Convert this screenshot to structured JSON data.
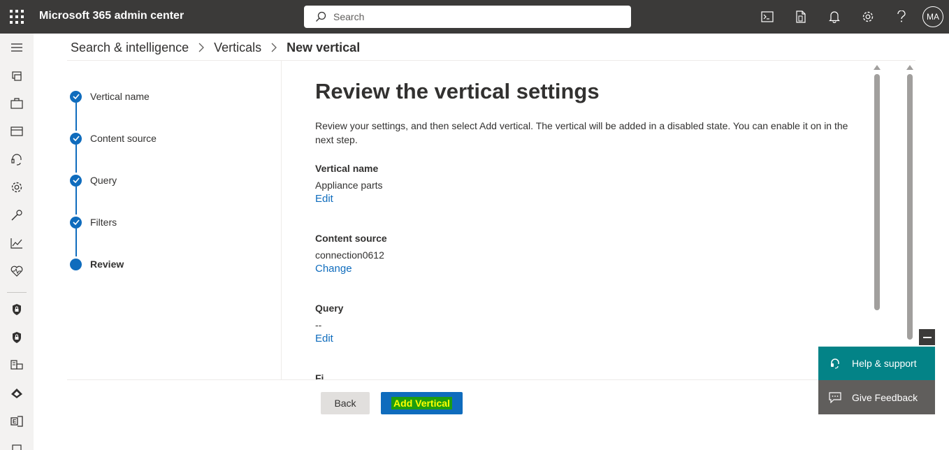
{
  "header": {
    "app_title": "Microsoft 365 admin center",
    "search_placeholder": "Search",
    "avatar_initials": "MA",
    "icons": [
      "waffle-icon",
      "terminal-icon",
      "mobile-app-icon",
      "bell-icon",
      "gear-icon",
      "help-icon"
    ]
  },
  "left_nav": {
    "items": [
      "menu-icon",
      "home-icon",
      "briefcase-icon",
      "billing-card-icon",
      "support-headset-icon",
      "settings-icon",
      "setup-wrench-icon",
      "reports-chart-icon",
      "health-heart-icon",
      "security-shield-icon",
      "compliance-shield-icon",
      "endpoint-manager-icon",
      "azure-ad-icon",
      "exchange-icon",
      "more-icon"
    ]
  },
  "breadcrumb": {
    "items": [
      "Search & intelligence",
      "Verticals"
    ],
    "current": "New vertical"
  },
  "stepper": {
    "steps": [
      {
        "label": "Vertical name",
        "state": "complete"
      },
      {
        "label": "Content source",
        "state": "complete"
      },
      {
        "label": "Query",
        "state": "complete"
      },
      {
        "label": "Filters",
        "state": "complete"
      },
      {
        "label": "Review",
        "state": "current"
      }
    ]
  },
  "main": {
    "title": "Review the vertical settings",
    "description": "Review your settings, and then select Add vertical. The vertical will be added in a disabled state. You can enable it on in the next step.",
    "sections": [
      {
        "title": "Vertical name",
        "value": "Appliance parts",
        "link": "Edit"
      },
      {
        "title": "Content source",
        "value": "connection0612",
        "link": "Change"
      },
      {
        "title": "Query",
        "value": "--",
        "link": "Edit"
      },
      {
        "title": "Fi"
      }
    ]
  },
  "footer": {
    "back_label": "Back",
    "add_label": "Add Vertical"
  },
  "help_panel": {
    "help_label": "Help & support",
    "feedback_label": "Give Feedback"
  },
  "colors": {
    "topbar": "#3b3a39",
    "accent": "#0f6cbd",
    "help_teal": "#038387",
    "feedback_gray": "#605e5c",
    "highlight_green": "#1e9e0f",
    "highlight_yellow": "#ffff00"
  }
}
